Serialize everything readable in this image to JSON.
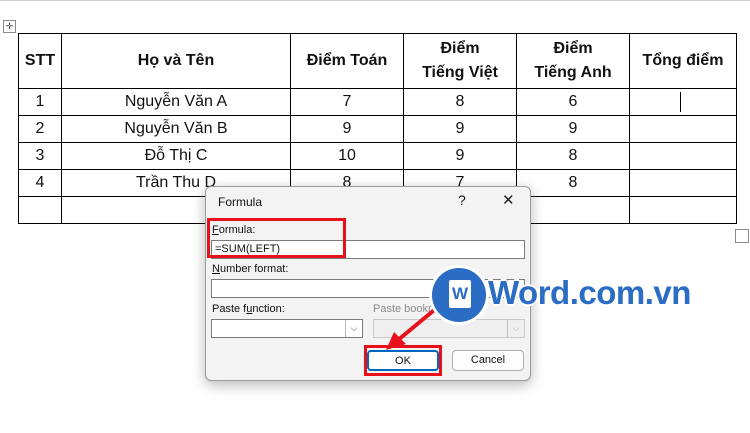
{
  "table": {
    "headers": [
      "STT",
      "Họ và Tên",
      "Điểm Toán",
      "Điểm\nTiếng Việt",
      "Điểm\nTiếng Anh",
      "Tổng điểm"
    ],
    "rows": [
      [
        "1",
        "Nguyễn Văn A",
        "7",
        "8",
        "6",
        ""
      ],
      [
        "2",
        "Nguyễn Văn B",
        "9",
        "9",
        "9",
        ""
      ],
      [
        "3",
        "Đỗ Thị C",
        "10",
        "9",
        "8",
        ""
      ],
      [
        "4",
        "Trần Thu D",
        "8",
        "7",
        "8",
        ""
      ],
      [
        "",
        "",
        "",
        "",
        "",
        ""
      ]
    ]
  },
  "dialog": {
    "title": "Formula",
    "help": "?",
    "close": "✕",
    "formula_label_ul": "F",
    "formula_label_rest": "ormula:",
    "formula_value": "=SUM(LEFT)",
    "number_format_label_ul": "N",
    "number_format_label_rest": "umber format:",
    "number_format_value": "",
    "paste_function_label_pre": "Paste f",
    "paste_function_label_ul": "u",
    "paste_function_label_rest": "nction:",
    "paste_bookmark_label": "Paste bookmark:",
    "ok_label": "OK",
    "cancel_label": "Cancel"
  },
  "logo": {
    "letter": "W",
    "text": "Word.com.vn"
  },
  "icons": {
    "move": "move-handle-icon",
    "dropdown": "chevron-down-icon",
    "close": "close-icon"
  },
  "colors": {
    "highlight": "#e8111b",
    "accent": "#0067c0",
    "logo": "#2b6cc4"
  }
}
